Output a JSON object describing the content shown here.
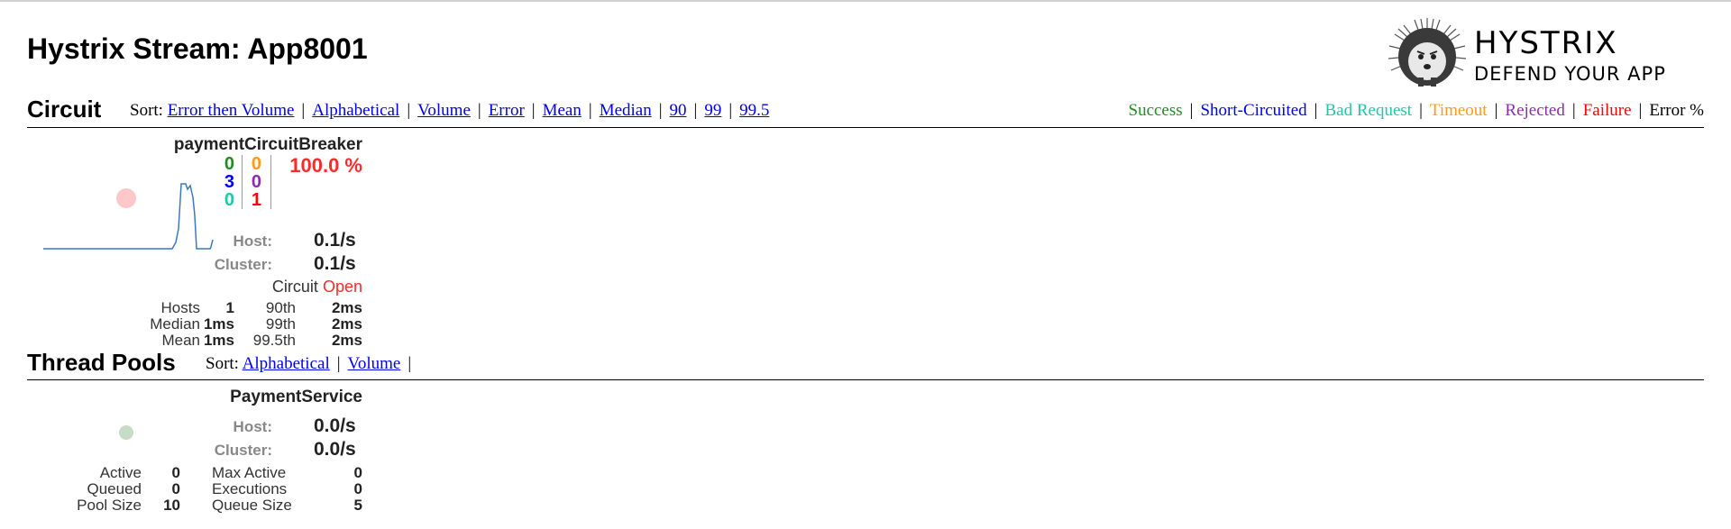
{
  "page": {
    "title": "Hystrix Stream: App8001"
  },
  "logo": {
    "line1": "HYSTRIX",
    "line2": "DEFEND YOUR APP",
    "icon": "hedgehog-icon"
  },
  "circuit_section": {
    "title": "Circuit",
    "sort_label": "Sort:",
    "sort_options": [
      "Error then Volume",
      "Alphabetical",
      "Volume",
      "Error",
      "Mean",
      "Median",
      "90",
      "99",
      "99.5"
    ],
    "legend": [
      "Success",
      "Short-Circuited",
      "Bad Request",
      "Timeout",
      "Rejected",
      "Failure",
      "Error %"
    ]
  },
  "circuit": {
    "name": "paymentCircuitBreaker",
    "counts": {
      "success": "0",
      "short_circuited": "3",
      "bad_request": "0",
      "timeout": "0",
      "rejected": "0",
      "failure": "1"
    },
    "error_pct": "100.0 %",
    "host_label": "Host:",
    "host_rate": "0.1/s",
    "cluster_label": "Cluster:",
    "cluster_rate": "0.1/s",
    "circuit_label": "Circuit",
    "circuit_state": "Open",
    "stats": {
      "hosts_label": "Hosts",
      "hosts": "1",
      "median_label": "Median",
      "median": "1ms",
      "mean_label": "Mean",
      "mean": "1ms",
      "p90_label": "90th",
      "p90": "2ms",
      "p99_label": "99th",
      "p99": "2ms",
      "p995_label": "99.5th",
      "p995": "2ms"
    },
    "colors": {
      "success": "#228b22",
      "short": "#0000ff",
      "bad": "#1fc8a4",
      "timeout": "#ff9a1a",
      "rejected": "#8b2caf",
      "failure": "#ff0000",
      "bubble": "#ffc7c7",
      "sparkline": "#3a78c2"
    }
  },
  "thread_pool_section": {
    "title": "Thread Pools",
    "sort_label": "Sort:",
    "sort_options": [
      "Alphabetical",
      "Volume"
    ]
  },
  "thread_pool": {
    "name": "PaymentService",
    "host_label": "Host:",
    "host_rate": "0.0/s",
    "cluster_label": "Cluster:",
    "cluster_rate": "0.0/s",
    "active_label": "Active",
    "active": "0",
    "queued_label": "Queued",
    "queued": "0",
    "pool_size_label": "Pool Size",
    "pool_size": "10",
    "max_active_label": "Max Active",
    "max_active": "0",
    "executions_label": "Executions",
    "executions": "0",
    "queue_size_label": "Queue Size",
    "queue_size": "5",
    "colors": {
      "bubble": "#c6dcc6"
    }
  }
}
